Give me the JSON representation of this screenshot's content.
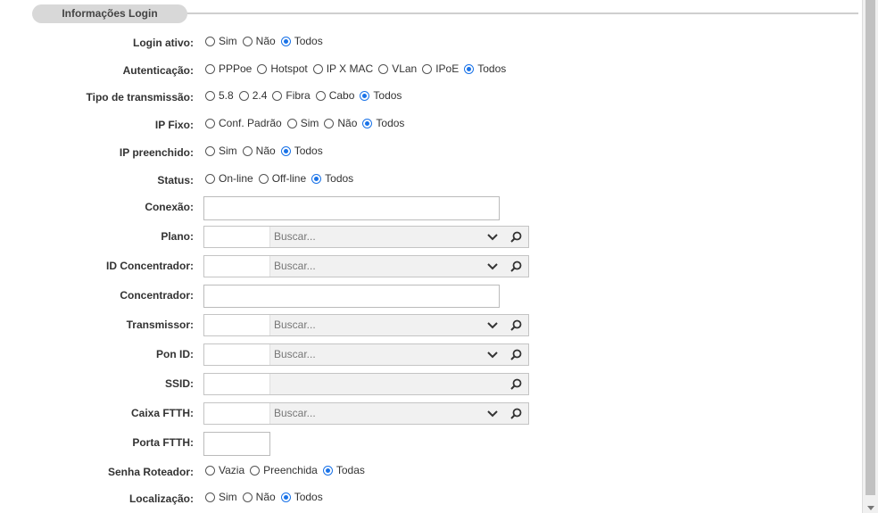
{
  "section_title": "Informações Login",
  "search_placeholder": "Buscar...",
  "rows": {
    "login_ativo": {
      "label": "Login ativo:",
      "options": [
        "Sim",
        "Não",
        "Todos"
      ]
    },
    "autenticacao": {
      "label": "Autenticação:",
      "options": [
        "PPPoe",
        "Hotspot",
        "IP X MAC",
        "VLan",
        "IPoE",
        "Todos"
      ]
    },
    "tipo_transmissao": {
      "label": "Tipo de transmissão:",
      "options": [
        "5.8",
        "2.4",
        "Fibra",
        "Cabo",
        "Todos"
      ]
    },
    "ip_fixo": {
      "label": "IP Fixo:",
      "options": [
        "Conf. Padrão",
        "Sim",
        "Não",
        "Todos"
      ]
    },
    "ip_preenchido": {
      "label": "IP preenchido:",
      "options": [
        "Sim",
        "Não",
        "Todos"
      ]
    },
    "status": {
      "label": "Status:",
      "options": [
        "On-line",
        "Off-line",
        "Todos"
      ]
    },
    "conexao": {
      "label": "Conexão:"
    },
    "plano": {
      "label": "Plano:"
    },
    "id_concentrador": {
      "label": "ID Concentrador:"
    },
    "concentrador": {
      "label": "Concentrador:"
    },
    "transmissor": {
      "label": "Transmissor:"
    },
    "pon_id": {
      "label": "Pon ID:"
    },
    "ssid": {
      "label": "SSID:"
    },
    "caixa_ftth": {
      "label": "Caixa FTTH:"
    },
    "porta_ftth": {
      "label": "Porta FTTH:"
    },
    "senha_roteador": {
      "label": "Senha Roteador:",
      "options": [
        "Vazia",
        "Preenchida",
        "Todas"
      ]
    },
    "localizacao": {
      "label": "Localização:",
      "options": [
        "Sim",
        "Não",
        "Todos"
      ]
    }
  },
  "colors": {
    "accent": "#1a73e8",
    "legend_bg": "#d8d8d8",
    "search_bg": "#f1f1f1"
  },
  "icons": {
    "dropdown": "chevron-down-icon",
    "search": "magnifier-icon"
  }
}
